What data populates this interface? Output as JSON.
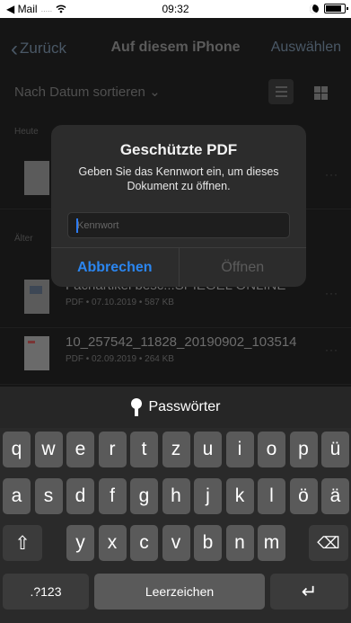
{
  "status": {
    "carrier": "◀ Mail",
    "signal": ".....",
    "wifi": "wifi",
    "time": "09:32"
  },
  "nav": {
    "back": "Zurück",
    "title": "Auf diesem iPhone",
    "select": "Auswählen"
  },
  "sort": {
    "label": "Nach Datum sortieren",
    "chevron": "⌄"
  },
  "sections": {
    "today": "Heute",
    "older": "Älter"
  },
  "files": [
    {
      "name": "",
      "meta": ""
    },
    {
      "name": "Fachartikel besc...SPIEGEL ONLINE",
      "meta": "PDF  •  07.10.2019  •  587 KB"
    },
    {
      "name": "10_257542_11828_20190902_103514",
      "meta": "PDF  •  02.09.2019  •  264 KB"
    }
  ],
  "more": "···",
  "dialog": {
    "title": "Geschützte PDF",
    "message": "Geben Sie das Kennwort ein, um dieses Dokument zu öffnen.",
    "placeholder": "Kennwort",
    "cancel": "Abbrechen",
    "open": "Öffnen"
  },
  "keyboard": {
    "suggestion": "Passwörter",
    "row1": [
      "q",
      "w",
      "e",
      "r",
      "t",
      "z",
      "u",
      "i",
      "o",
      "p",
      "ü"
    ],
    "row2": [
      "a",
      "s",
      "d",
      "f",
      "g",
      "h",
      "j",
      "k",
      "l",
      "ö",
      "ä"
    ],
    "row3": [
      "y",
      "x",
      "c",
      "v",
      "b",
      "n",
      "m"
    ],
    "shift": "⇧",
    "delete": "⌫",
    "numbers": ".?123",
    "space": "Leerzeichen",
    "return": "↵"
  }
}
